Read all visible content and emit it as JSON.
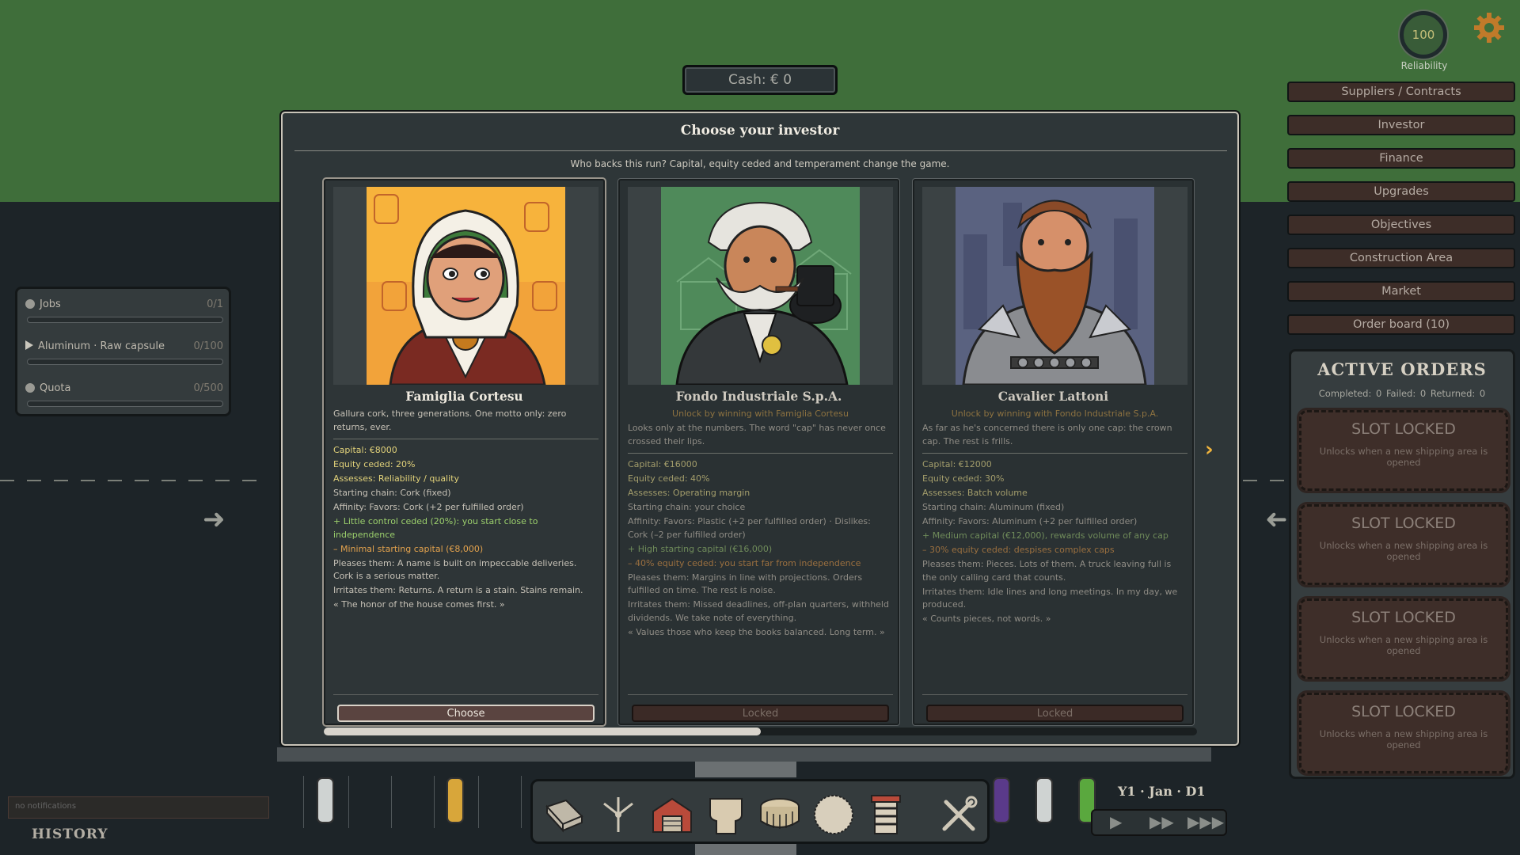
{
  "hud": {
    "cash": "Cash: € 0",
    "reliability_value": "100",
    "reliability_label": "Reliability"
  },
  "menu": [
    {
      "label": "Suppliers / Contracts"
    },
    {
      "label": "Investor"
    },
    {
      "label": "Finance"
    },
    {
      "label": "Upgrades"
    },
    {
      "label": "Objectives"
    },
    {
      "label": "Construction Area"
    },
    {
      "label": "Market"
    },
    {
      "label": "Order board (10)"
    }
  ],
  "orders": {
    "title": "ACTIVE ORDERS",
    "stats": "Completed: 0   Failed: 0   Returned: 0",
    "slots": [
      {
        "title": "SLOT LOCKED",
        "sub": "Unlocks when a new shipping area is opened"
      },
      {
        "title": "SLOT LOCKED",
        "sub": "Unlocks when a new shipping area is opened"
      },
      {
        "title": "SLOT LOCKED",
        "sub": "Unlocks when a new shipping area is opened"
      },
      {
        "title": "SLOT LOCKED",
        "sub": "Unlocks when a new shipping area is opened"
      }
    ]
  },
  "left_panel": {
    "jobs": {
      "label": "Jobs",
      "value": "0/1"
    },
    "aluminum": {
      "label": "Aluminum · Raw capsule",
      "value": "0/100"
    },
    "quota": {
      "label": "Quota",
      "value": "0/500"
    }
  },
  "notifications": "no notifications",
  "history": "HISTORY",
  "date": "Y1 · Jan · D1",
  "modal": {
    "title": "Choose your investor",
    "subtitle": "Who backs this run? Capital, equity ceded and temperament change the game.",
    "cards": [
      {
        "name": "Famiglia Cortesu",
        "desc": "Gallura cork, three generations. One motto only: zero returns, ever.",
        "capital": "Capital: €8000",
        "equity": "Equity ceded: 20%",
        "assesses": "Assesses: Reliability / quality",
        "chain": "Starting chain: Cork (fixed)",
        "affinity": "Affinity: Favors: Cork (+2 per fulfilled order)",
        "pro": "+ Little control ceded (20%): you start close to independence",
        "con": "– Minimal starting capital (€8,000)",
        "pleases": "Pleases them: A name is built on impeccable deliveries. Cork is a serious matter.",
        "irritates": "Irritates them: Returns. A return is a stain. Stains remain.",
        "quote": "« The honor of the house comes first. »",
        "button": "Choose"
      },
      {
        "name": "Fondo Industriale S.p.A.",
        "unlock": "Unlock by winning with Famiglia Cortesu",
        "desc": "Looks only at the numbers. The word \"cap\" has never once crossed their lips.",
        "capital": "Capital: €16000",
        "equity": "Equity ceded: 40%",
        "assesses": "Assesses: Operating margin",
        "chain": "Starting chain: your choice",
        "affinity": "Affinity: Favors: Plastic (+2 per fulfilled order)  ·  Dislikes: Cork (–2 per fulfilled order)",
        "pro": "+ High starting capital (€16,000)",
        "con": "– 40% equity ceded: you start far from independence",
        "pleases": "Pleases them: Margins in line with projections. Orders fulfilled on time. The rest is noise.",
        "irritates": "Irritates them: Missed deadlines, off-plan quarters, withheld dividends. We take note of everything.",
        "quote": "« Values those who keep the books balanced. Long term. »",
        "button": "Locked"
      },
      {
        "name": "Cavalier Lattoni",
        "unlock": "Unlock by winning with Fondo Industriale S.p.A.",
        "desc": "As far as he's concerned there is only one cap: the crown cap. The rest is frills.",
        "capital": "Capital: €12000",
        "equity": "Equity ceded: 30%",
        "assesses": "Assesses: Batch volume",
        "chain": "Starting chain: Aluminum (fixed)",
        "affinity": "Affinity: Favors: Aluminum (+2 per fulfilled order)",
        "pro": "+ Medium capital (€12,000), rewards volume of any cap",
        "con": "– 30% equity ceded: despises complex caps",
        "pleases": "Pleases them: Pieces. Lots of them. A truck leaving full is the only calling card that counts.",
        "irritates": "Irritates them: Idle lines and long meetings. In my day, we produced.",
        "quote": "« Counts pieces, not words. »",
        "button": "Locked"
      }
    ],
    "scroll_progress": 0.5
  },
  "colors": {
    "accent": "#f0b43c",
    "grass": "#3f6e3a",
    "button": "#3d2d28"
  },
  "icons": [
    "gear-icon",
    "next-arrow-icon",
    "play-icon",
    "fast-forward-icon",
    "fastest-forward-icon",
    "conveyor-icon",
    "split-icon",
    "warehouse-icon",
    "cork-icon",
    "crown-cap-icon",
    "disc-icon",
    "spring-icon",
    "tools-icon"
  ]
}
